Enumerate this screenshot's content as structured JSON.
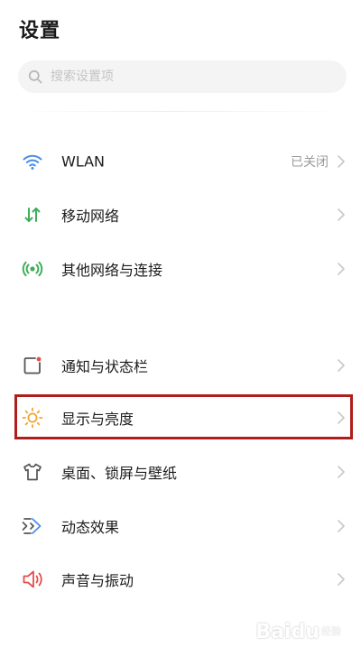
{
  "page": {
    "title": "设置"
  },
  "search": {
    "placeholder": "搜索设置项",
    "icon": "search-icon"
  },
  "groups": [
    {
      "items": [
        {
          "id": "wlan",
          "label": "WLAN",
          "value": "已关闭",
          "icon": "wifi-icon",
          "icon_color": "#4a8ee8"
        },
        {
          "id": "mobile-network",
          "label": "移动网络",
          "icon": "mobile-data-icon",
          "icon_color": "#3fae5a"
        },
        {
          "id": "other-networks",
          "label": "其他网络与连接",
          "icon": "connection-icon",
          "icon_color": "#3fae5a"
        }
      ]
    },
    {
      "items": [
        {
          "id": "notifications",
          "label": "通知与状态栏",
          "icon": "notification-icon",
          "icon_color": "#e74c4c"
        },
        {
          "id": "display",
          "label": "显示与亮度",
          "icon": "sun-icon",
          "icon_color": "#f0a630",
          "highlighted": true
        },
        {
          "id": "wallpaper",
          "label": "桌面、锁屏与壁纸",
          "icon": "shirt-icon",
          "icon_color": "#5a5a5a"
        },
        {
          "id": "effects",
          "label": "动态效果",
          "icon": "animation-icon",
          "icon_color": "#4a8ee8"
        },
        {
          "id": "sound",
          "label": "声音与振动",
          "icon": "speaker-icon",
          "icon_color": "#e74c4c"
        }
      ]
    }
  ],
  "colors": {
    "highlight_border": "#b01d1d",
    "chevron": "#c8c8c8",
    "secondary_text": "#9a9a9a"
  },
  "watermark": {
    "brand": "Baidu",
    "sub": "经验"
  }
}
